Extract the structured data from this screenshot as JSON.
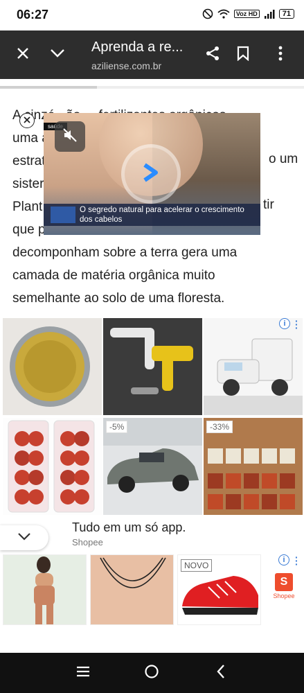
{
  "status_bar": {
    "time": "06:27",
    "volte": "Voz HD",
    "network": "4G",
    "battery": "71"
  },
  "toolbar": {
    "title": "Aprenda a re...",
    "url": "aziliense.com.br"
  },
  "article": {
    "lines": [
      "A cinzé...ão ... fertilizantes orgânicos,",
      "uma a...",
      "estrat...",
      "sister...",
      "Plant...",
      "que p...",
      "decomponham sobre a terra gera uma",
      "camada de matéria orgânica muito",
      "semelhante ao solo de uma floresta."
    ],
    "right_fragments": [
      "o um",
      "tir"
    ]
  },
  "video_ad": {
    "tag": "saúde",
    "caption": "O segredo natural para acelerar o crescimento dos cabelos"
  },
  "product_grid": {
    "badges": [
      "-5%",
      "-33%"
    ],
    "items": [
      "coin",
      "yellow-tool",
      "toy-truck",
      "candy-box",
      "model-car",
      "spice-bags"
    ]
  },
  "shopee_ad": {
    "headline": "Tudo em um só app.",
    "brand": "Shopee",
    "badge_new": "NOVO",
    "logo_label": "Shopee"
  },
  "colors": {
    "toolbar_bg": "#2d2d2d",
    "shopee_orange": "#ee4d2d",
    "info_blue": "#3a7bd5"
  }
}
